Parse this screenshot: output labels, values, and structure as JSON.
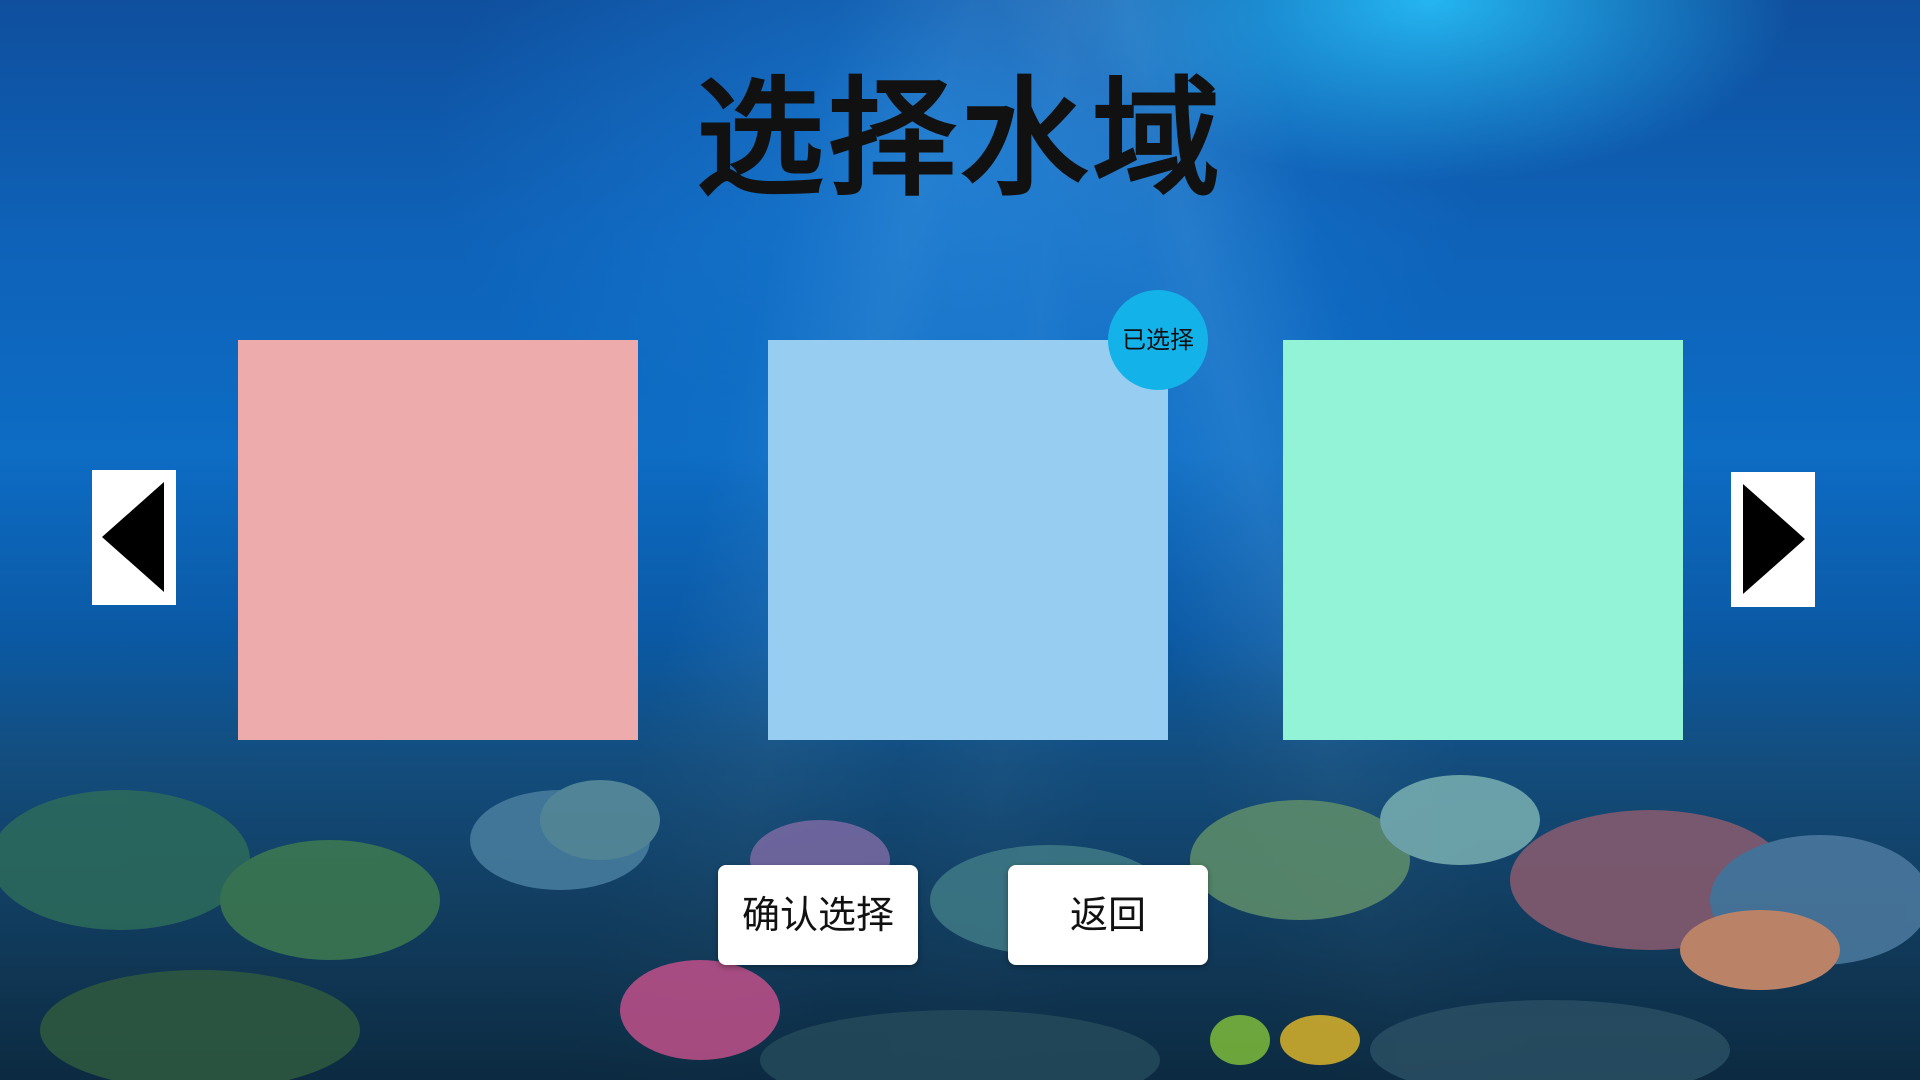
{
  "title": "选择水域",
  "nav": {
    "prev_icon": "triangle-left-icon",
    "next_icon": "triangle-right-icon"
  },
  "cards": [
    {
      "color": "#eeabab",
      "selected": false
    },
    {
      "color": "#97cdf0",
      "selected": true
    },
    {
      "color": "#93f3d6",
      "selected": false
    }
  ],
  "selected_badge": "已选择",
  "buttons": {
    "confirm": "确认选择",
    "back": "返回"
  },
  "colors": {
    "badge": "#13b3ea",
    "title_text": "#111111"
  }
}
